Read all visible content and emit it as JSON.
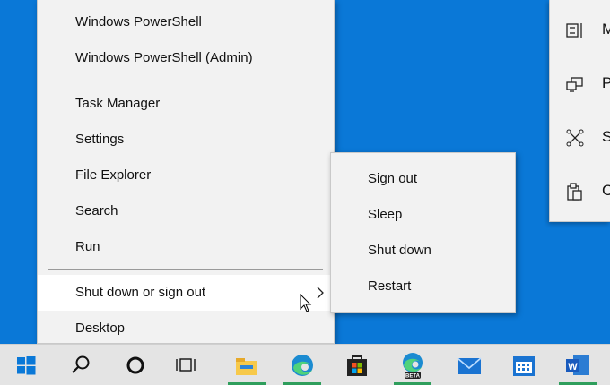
{
  "winx_menu": {
    "items": [
      {
        "label": "Windows PowerShell"
      },
      {
        "label": "Windows PowerShell (Admin)"
      },
      {
        "label": "Task Manager"
      },
      {
        "label": "Settings"
      },
      {
        "label": "File Explorer"
      },
      {
        "label": "Search"
      },
      {
        "label": "Run"
      },
      {
        "label": "Shut down or sign out",
        "has_submenu": true,
        "highlighted": true
      },
      {
        "label": "Desktop"
      }
    ]
  },
  "shutdown_submenu": {
    "items": [
      {
        "label": "Sign out"
      },
      {
        "label": "Sleep"
      },
      {
        "label": "Shut down"
      },
      {
        "label": "Restart"
      }
    ]
  },
  "right_flyout": {
    "items": [
      {
        "label": "M",
        "icon": "window-layout-icon"
      },
      {
        "label": "P",
        "icon": "project-display-icon"
      },
      {
        "label": "S",
        "icon": "connect-icon"
      },
      {
        "label": "C",
        "icon": "clipboard-icon"
      }
    ]
  },
  "taskbar": {
    "icons": [
      "windows-start-icon",
      "search-icon",
      "cortana-icon",
      "task-view-icon",
      "file-explorer-icon",
      "edge-icon",
      "microsoft-store-icon",
      "edge-beta-icon",
      "mail-icon",
      "calendar-icon",
      "word-icon"
    ],
    "edge_beta_badge": "BETA",
    "word_letter": "W"
  },
  "colors": {
    "desktop": "#0a78d7",
    "menu_bg": "#f2f2f2",
    "hover_bg": "#ffffff",
    "taskbar_bg": "#e4e4e4",
    "running_indicator": "#2f9e5c"
  }
}
